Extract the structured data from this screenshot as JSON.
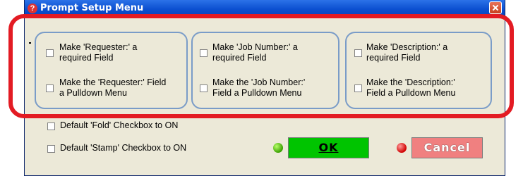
{
  "window": {
    "title": "Prompt Setup Menu"
  },
  "groups": [
    {
      "required_label": "Make 'Requester:' a\nrequired Field",
      "pulldown_label": "Make the 'Requester:' Field\na Pulldown Menu"
    },
    {
      "required_label": "Make 'Job Number:' a\nrequired Field",
      "pulldown_label": "Make the 'Job Number:'\nField a Pulldown Menu"
    },
    {
      "required_label": "Make 'Description:' a\nrequired Field",
      "pulldown_label": "Make the 'Description:'\nField a Pulldown Menu"
    }
  ],
  "defaults": {
    "fold_label": "Default 'Fold' Checkbox to ON",
    "stamp_label": "Default 'Stamp' Checkbox to ON"
  },
  "buttons": {
    "ok_label": "OK",
    "cancel_label": "Cancel"
  },
  "colors": {
    "ok": "#00c400",
    "cancel": "#f08080",
    "highlight": "#e31b23"
  }
}
